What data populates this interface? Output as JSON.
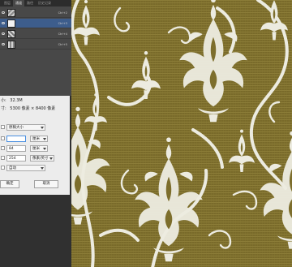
{
  "channels_panel": {
    "tabs": [
      "图层",
      "通道",
      "路径",
      "历史记录"
    ],
    "active_tab": 1,
    "rows": [
      {
        "shortcut": "Ctrl+2",
        "selected": false
      },
      {
        "shortcut": "Ctrl+3",
        "selected": true
      },
      {
        "shortcut": "Ctrl+4",
        "selected": false
      },
      {
        "shortcut": "Ctrl+5",
        "selected": false
      }
    ]
  },
  "size_dialog": {
    "file_size_label": "小:",
    "file_size_value": "32.3M",
    "dimensions_label": "寸:",
    "dimensions_value": "5300 像素 × 8400 像素",
    "fit_to": "原稿大小",
    "width_value": "",
    "width_unit": "厘米",
    "height_value": "84",
    "height_unit": "厘米",
    "resolution_value": "254",
    "resolution_unit": "像素/英寸",
    "resample_value": "自动",
    "ok_label": "确定",
    "cancel_label": "取消"
  },
  "colors": {
    "panel_bg": "#484848",
    "selection": "#3d5d8c",
    "dialog_bg": "#ececec",
    "fabric": "#7d6e2c",
    "damask": "#ecebe0"
  }
}
